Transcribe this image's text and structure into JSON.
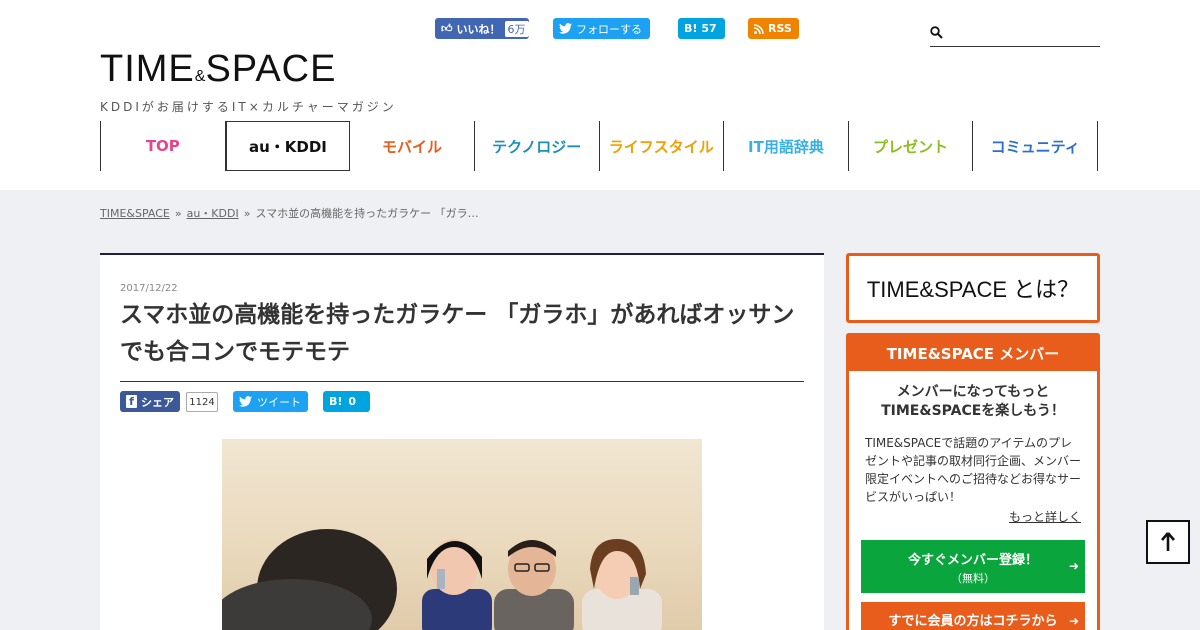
{
  "header": {
    "logo": {
      "main": "TIME",
      "amp": "&",
      "main2": "SPACE",
      "tagline": "KDDIがお届けするIT×カルチャーマガジン"
    },
    "social": {
      "like_label": "いいね！",
      "like_count": "6万",
      "twitter_follow": "フォローする",
      "hatena_label": "B!",
      "hatena_count": "57",
      "rss": "RSS"
    },
    "search": {
      "placeholder": ""
    }
  },
  "nav": [
    {
      "label": "TOP",
      "color": "#e8448c"
    },
    {
      "label": "au・KDDI",
      "color": "#111111"
    },
    {
      "label": "モバイル",
      "color": "#e85d1c"
    },
    {
      "label": "テクノロジー",
      "color": "#1a8fbf"
    },
    {
      "label": "ライフスタイル",
      "color": "#f0a000"
    },
    {
      "label": "IT用語辞典",
      "color": "#3ab0e2"
    },
    {
      "label": "プレゼント",
      "color": "#8cc020"
    },
    {
      "label": "コミュニティ",
      "color": "#2a70c8"
    }
  ],
  "breadcrumb": {
    "home": "TIME&SPACE",
    "category": "au・KDDI",
    "current": "スマホ並の高機能を持ったガラケー 「ガラ…",
    "sep": "»"
  },
  "article": {
    "date": "2017/12/22",
    "title": "スマホ並の高機能を持ったガラケー 「ガラホ」があればオッサンでも合コンでモテモテ",
    "share": {
      "fb_label": "シェア",
      "fb_count": "1124",
      "tweet_label": "ツイート",
      "hatena_label": "B!",
      "hatena_count": "0"
    }
  },
  "sidebar": {
    "about_title": "TIME&SPACE とは？",
    "member": {
      "header": "TIME&SPACE メンバー",
      "lead1": "メンバーになってもっと",
      "lead2": "TIME&SPACEを楽しもう！",
      "description": "TIME&SPACEで話題のアイテムのプレゼントや記事の取材同行企画、メンバー限定イベントへのご招待などお得なサービスがいっぱい！",
      "more_link": "もっと詳しく",
      "register_label": "今すぐメンバー登録！",
      "register_sub": "（無料）",
      "login_label": "すでに会員の方はコチラから"
    }
  },
  "colors": {
    "accent": "#e85d1c",
    "navy": "#1c1f45",
    "green": "#0aa53c"
  },
  "icons": [
    "search-icon",
    "facebook-like-icon",
    "twitter-icon",
    "hatena-icon",
    "rss-icon",
    "arrow-right-icon",
    "arrow-up-icon"
  ]
}
